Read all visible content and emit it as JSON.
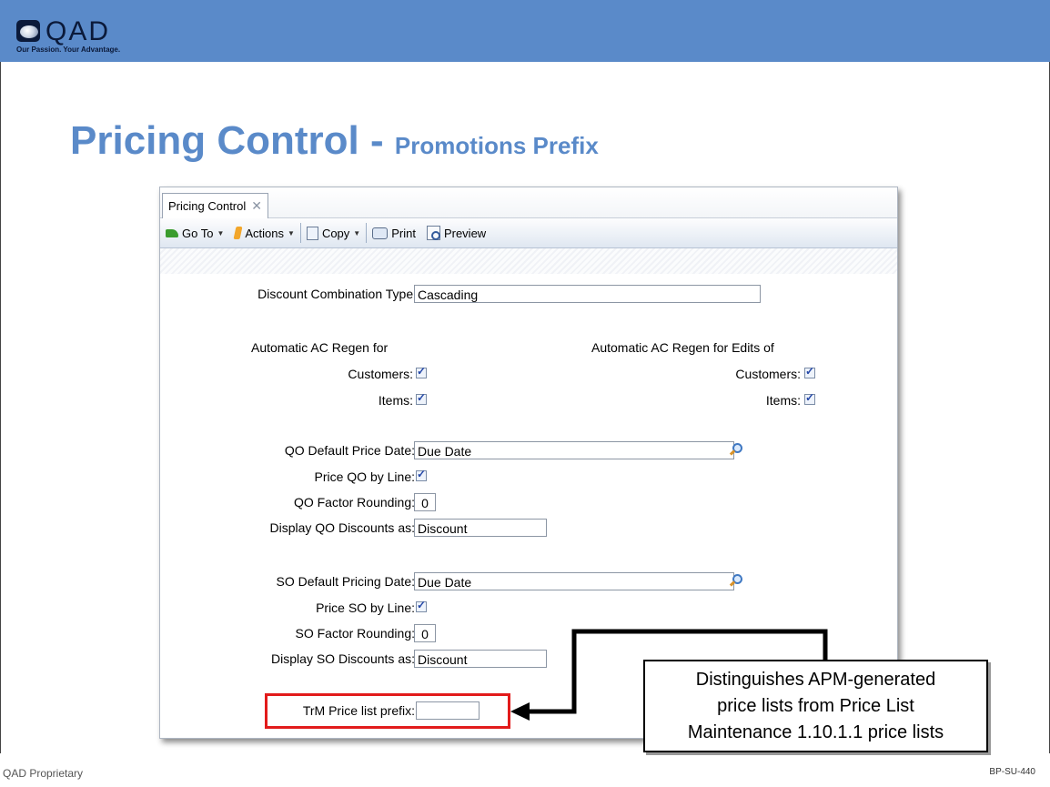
{
  "brand": {
    "logo_text": "QAD",
    "tagline": "Our Passion. Your Advantage.",
    "header_color": "#5a8ac9"
  },
  "slide": {
    "title_main": "Pricing Control - ",
    "title_sub": "Promotions Prefix"
  },
  "window": {
    "tab_label": "Pricing Control",
    "tab_close_icon": "close-icon",
    "toolbar": {
      "goto": "Go To",
      "actions": "Actions",
      "copy": "Copy",
      "print": "Print",
      "preview": "Preview"
    }
  },
  "form": {
    "discount_combination_type": {
      "label": "Discount Combination Type:",
      "value": "Cascading"
    },
    "regen_left": {
      "heading": "Automatic AC Regen for",
      "customers_label": "Customers:",
      "items_label": "Items:",
      "customers_checked": true,
      "items_checked": true
    },
    "regen_right": {
      "heading": "Automatic AC Regen for Edits of",
      "customers_label": "Customers:",
      "items_label": "Items:",
      "customers_checked": true,
      "items_checked": true
    },
    "qo_default_price_date": {
      "label": "QO Default Price Date:",
      "value": "Due Date"
    },
    "price_qo_by_line": {
      "label": "Price QO by Line:",
      "checked": true
    },
    "qo_factor_rounding": {
      "label": "QO Factor Rounding:",
      "value": "0"
    },
    "display_qo_discounts_as": {
      "label": "Display QO Discounts as:",
      "value": "Discount"
    },
    "so_default_pricing_date": {
      "label": "SO Default Pricing Date:",
      "value": "Due Date"
    },
    "price_so_by_line": {
      "label": "Price SO by Line:",
      "checked": true
    },
    "so_factor_rounding": {
      "label": "SO Factor Rounding:",
      "value": "0"
    },
    "display_so_discounts_as": {
      "label": "Display SO Discounts as:",
      "value": "Discount"
    },
    "trm_price_list_prefix": {
      "label": "TrM Price list prefix:",
      "value": ""
    }
  },
  "callout": {
    "line1": "Distinguishes APM-generated",
    "line2": "price lists from Price List",
    "line3": "Maintenance 1.10.1.1 price lists"
  },
  "footer": {
    "left": "QAD Proprietary",
    "right": "BP-SU-440"
  },
  "colors": {
    "title": "#5a8ac9",
    "highlight": "#e21b1b"
  }
}
